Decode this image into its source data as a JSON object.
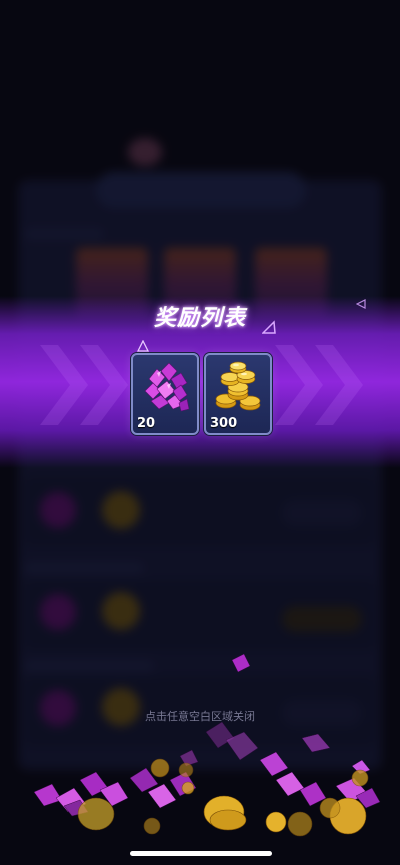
{
  "reward_list": {
    "title": "奖励列表",
    "items": [
      {
        "name": "gem",
        "icon": "purple-gem-pile-icon",
        "count": "20"
      },
      {
        "name": "gold-coin",
        "icon": "gold-coin-pile-icon",
        "count": "300"
      }
    ]
  },
  "close_hint": "点击任意空白区域关闭",
  "colors": {
    "banner_purple": "#9628e6",
    "card_border": "#7f8bc8",
    "gem": "#c23bd6",
    "coin": "#e6b422"
  }
}
